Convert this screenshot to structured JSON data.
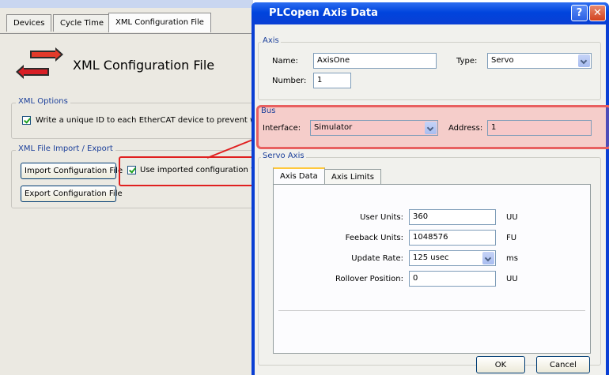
{
  "left": {
    "tabs": [
      "Devices",
      "Cycle Time",
      "XML Configuration File"
    ],
    "page_title": "XML Configuration File",
    "xml_options": {
      "title": "XML Options",
      "checkbox_label": "Write a unique ID to each EtherCAT device to prevent wirin"
    },
    "import_export": {
      "title": "XML File Import / Export",
      "import_button": "Import Configuration File",
      "export_button": "Export Configuration File",
      "use_imported_label": "Use imported configuration file"
    }
  },
  "dialog": {
    "title": "PLCopen Axis Data",
    "help_glyph": "?",
    "close_glyph": "✕",
    "axis": {
      "title": "Axis",
      "name_label": "Name:",
      "name_value": "AxisOne",
      "type_label": "Type:",
      "type_value": "Servo",
      "number_label": "Number:",
      "number_value": "1"
    },
    "bus": {
      "title": "Bus",
      "interface_label": "Interface:",
      "interface_value": "Simulator",
      "address_label": "Address:",
      "address_value": "1"
    },
    "servo": {
      "title": "Servo Axis",
      "tabs": [
        "Axis Data",
        "Axis Limits"
      ],
      "rows": [
        {
          "label": "User Units:",
          "value": "360",
          "unit": "UU"
        },
        {
          "label": "Feeback Units:",
          "value": "1048576",
          "unit": "FU"
        },
        {
          "label": "Update Rate:",
          "value": "125 usec",
          "unit": "ms"
        },
        {
          "label": "Rollover Position:",
          "value": "0",
          "unit": "UU"
        }
      ]
    },
    "ok_button": "OK",
    "cancel_button": "Cancel"
  },
  "colors": {
    "title_bar": "#0a3fd4",
    "annotation_red": "#e02020",
    "group_title": "#1b3f9a"
  }
}
